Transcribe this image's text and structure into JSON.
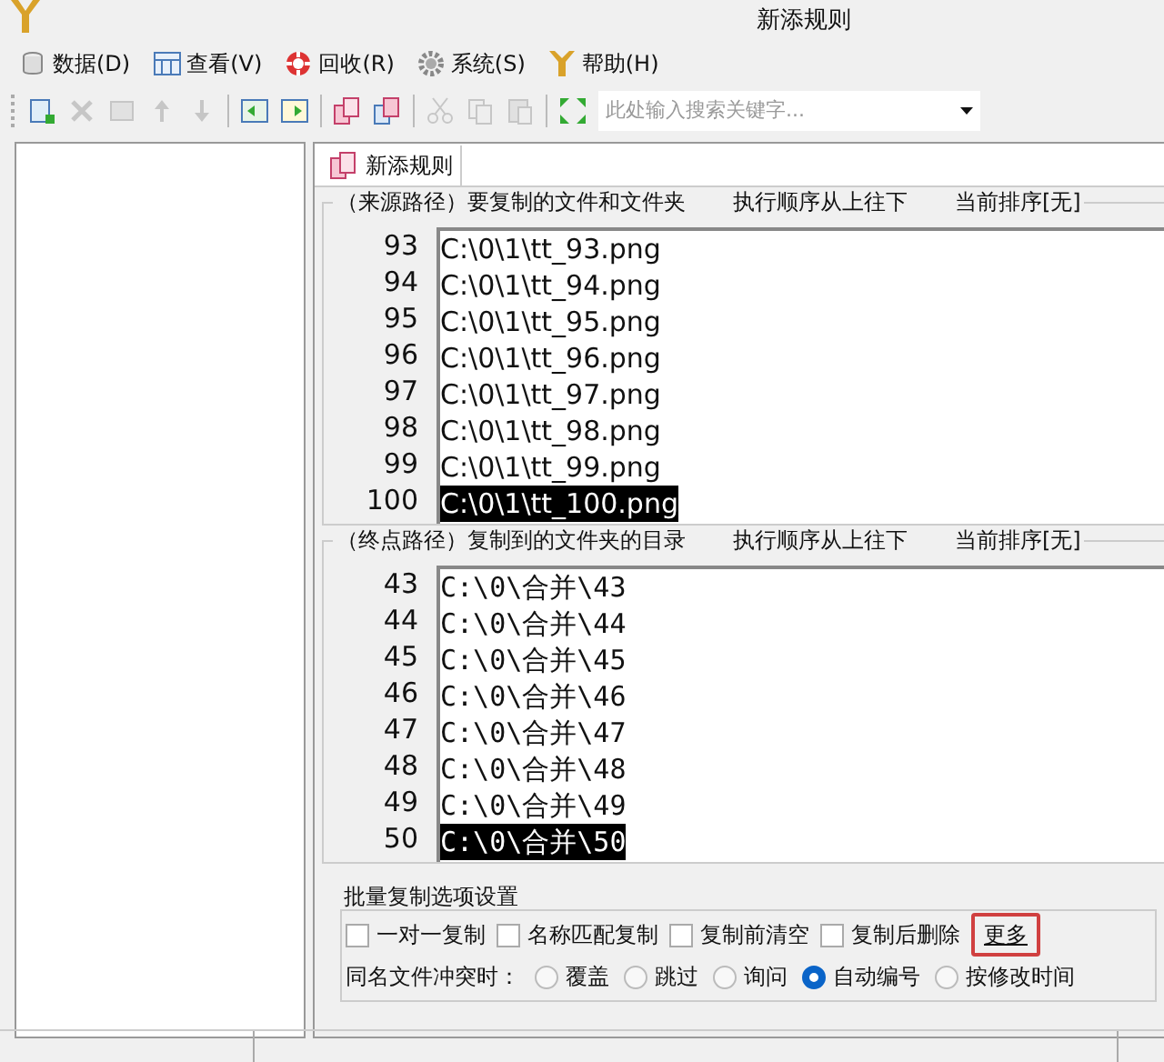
{
  "window": {
    "title": "新添规则"
  },
  "menu": [
    {
      "label": "数据(D)"
    },
    {
      "label": "查看(V)"
    },
    {
      "label": "回收(R)"
    },
    {
      "label": "系统(S)"
    },
    {
      "label": "帮助(H)"
    }
  ],
  "toolbar": {
    "buttons": [
      {
        "kind": "new",
        "disabled": false
      },
      {
        "kind": "delete",
        "disabled": true
      },
      {
        "kind": "blank",
        "disabled": true
      },
      {
        "kind": "up",
        "disabled": true
      },
      {
        "kind": "down",
        "disabled": true
      },
      {
        "kind": "sep"
      },
      {
        "kind": "import",
        "disabled": false
      },
      {
        "kind": "export",
        "disabled": false
      },
      {
        "kind": "sep"
      },
      {
        "kind": "copy",
        "disabled": false
      },
      {
        "kind": "paste",
        "disabled": false
      },
      {
        "kind": "sep"
      },
      {
        "kind": "cut",
        "disabled": true
      },
      {
        "kind": "copy2",
        "disabled": true
      },
      {
        "kind": "paste2",
        "disabled": true
      },
      {
        "kind": "sep"
      },
      {
        "kind": "expand",
        "disabled": false
      }
    ],
    "search": {
      "placeholder": "此处输入搜索关键字..."
    }
  },
  "tab": {
    "label": "新添规则",
    "selected": true
  },
  "source": {
    "title": "（来源路径）要复制的文件和文件夹",
    "order": "执行顺序从上往下",
    "sort": "当前排序[无]",
    "rows": [
      {
        "n": "93",
        "path": "C:\\0\\1\\tt_93.png",
        "selected": false
      },
      {
        "n": "94",
        "path": "C:\\0\\1\\tt_94.png",
        "selected": false
      },
      {
        "n": "95",
        "path": "C:\\0\\1\\tt_95.png",
        "selected": false
      },
      {
        "n": "96",
        "path": "C:\\0\\1\\tt_96.png",
        "selected": false
      },
      {
        "n": "97",
        "path": "C:\\0\\1\\tt_97.png",
        "selected": false
      },
      {
        "n": "98",
        "path": "C:\\0\\1\\tt_98.png",
        "selected": false
      },
      {
        "n": "99",
        "path": "C:\\0\\1\\tt_99.png",
        "selected": false
      },
      {
        "n": "100",
        "path": "C:\\0\\1\\tt_100.png",
        "selected": true
      }
    ]
  },
  "target": {
    "title": "（终点路径）复制到的文件夹的目录",
    "order": "执行顺序从上往下",
    "sort": "当前排序[无]",
    "rows": [
      {
        "n": "43",
        "path": "C:\\0\\合并\\43",
        "selected": false
      },
      {
        "n": "44",
        "path": "C:\\0\\合并\\44",
        "selected": false
      },
      {
        "n": "45",
        "path": "C:\\0\\合并\\45",
        "selected": false
      },
      {
        "n": "46",
        "path": "C:\\0\\合并\\46",
        "selected": false
      },
      {
        "n": "47",
        "path": "C:\\0\\合并\\47",
        "selected": false
      },
      {
        "n": "48",
        "path": "C:\\0\\合并\\48",
        "selected": false
      },
      {
        "n": "49",
        "path": "C:\\0\\合并\\49",
        "selected": false
      },
      {
        "n": "50",
        "path": "C:\\0\\合并\\50",
        "selected": true
      }
    ]
  },
  "options": {
    "title": "批量复制选项设置",
    "checkboxes": [
      {
        "label": "一对一复制",
        "checked": false
      },
      {
        "label": "名称匹配复制",
        "checked": false
      },
      {
        "label": "复制前清空",
        "checked": false
      },
      {
        "label": "复制后删除",
        "checked": false
      }
    ],
    "more": "更多",
    "conflict_label": "同名文件冲突时：",
    "radios": [
      {
        "label": "覆盖",
        "selected": false
      },
      {
        "label": "跳过",
        "selected": false
      },
      {
        "label": "询问",
        "selected": false
      },
      {
        "label": "自动编号",
        "selected": true
      },
      {
        "label": "按修改时间",
        "selected": false
      }
    ]
  }
}
